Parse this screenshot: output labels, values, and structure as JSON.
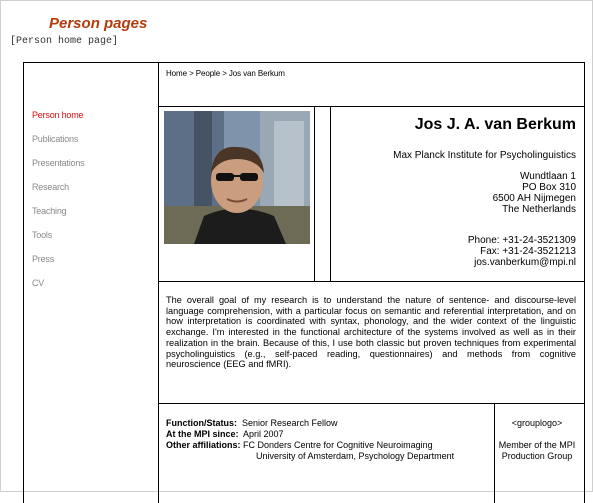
{
  "header": {
    "title": "Person pages",
    "subtitle": "[Person home page]"
  },
  "breadcrumb": "Home > People > Jos van Berkum",
  "sidebar": {
    "items": [
      {
        "label": "Person home",
        "active": true
      },
      {
        "label": "Publications",
        "active": false
      },
      {
        "label": "Presentations",
        "active": false
      },
      {
        "label": "Research",
        "active": false
      },
      {
        "label": "Teaching",
        "active": false
      },
      {
        "label": "Tools",
        "active": false
      },
      {
        "label": "Press",
        "active": false
      },
      {
        "label": "CV",
        "active": false
      }
    ]
  },
  "person": {
    "name": "Jos J. A. van Berkum",
    "institute": "Max Planck Institute for Psycholinguistics",
    "address": [
      "Wundtlaan 1",
      "PO Box 310",
      "6500 AH Nijmegen",
      "The Netherlands"
    ],
    "phone": "Phone: +31-24-3521309",
    "fax": "Fax: +31-24-3521213",
    "email": "jos.vanberkum@mpi.nl"
  },
  "bio": "The overall goal of my research is to understand the nature of sentence- and discourse-level language comprehension, with a particular focus on semantic and referential interpretation, and on how interpretation is coordinated with syntax, phonology, and the wider context of the linguistic exchange. I'm interested in the functional architecture of the systems involved as well as in their realization in the brain. Because of this, I use both classic but proven techniques from experimental psycholinguistics (e.g., self-paced reading, questionnaires) and methods from cognitive neuroscience (EEG and fMRI).",
  "function": {
    "status_label": "Function/Status:",
    "status_value": "Senior Research Fellow",
    "since_label": "At the MPI since:",
    "since_value": "April 2007",
    "affil_label": "Other affiliations:",
    "affil_value1": "FC Donders Centre for Cognitive Neuroimaging",
    "affil_value2": "University of Amsterdam, Psychology Department"
  },
  "grouplogo": {
    "placeholder": "<grouplogo>",
    "member": "Member of the MPI Production Group"
  }
}
